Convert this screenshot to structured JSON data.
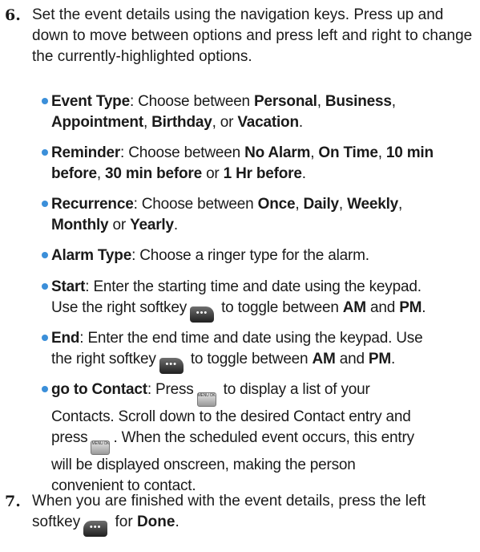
{
  "step6": {
    "number": "6.",
    "text": "Set the event details using the navigation keys. Press up and down to move between options and press left and right to change the currently-highlighted options."
  },
  "bullets": {
    "event_type": {
      "label": "Event Type",
      "t1": ": Choose between ",
      "o1": "Personal",
      "s1": ", ",
      "o2": "Business",
      "s2": ",",
      "o3": "Appointment",
      "s3": ", ",
      "o4": "Birthday",
      "s4": ", or ",
      "o5": "Vacation",
      "s5": "."
    },
    "reminder": {
      "label": "Reminder",
      "t1": ": Choose between ",
      "o1": "No Alarm",
      "s1": ", ",
      "o2": "On Time",
      "s2": ", ",
      "o3": "10 min",
      "o3b": "before",
      "s3": ", ",
      "o4": "30 min before",
      "s4": " or ",
      "o5": "1 Hr before",
      "s5": "."
    },
    "recurrence": {
      "label": "Recurrence",
      "t1": ": Choose between ",
      "o1": "Once",
      "s1": ", ",
      "o2": "Daily",
      "s2": ", ",
      "o3": "Weekly",
      "s3": ",",
      "o4": "Monthly",
      "s4": " or ",
      "o5": "Yearly",
      "s5": "."
    },
    "alarm_type": {
      "label": "Alarm Type",
      "t1": ": Choose a ringer type for the alarm."
    },
    "start": {
      "label": "Start",
      "t1": ": Enter the starting time and date using the keypad.",
      "t2": "Use the right softkey",
      "t3": " to toggle between ",
      "am": "AM",
      "t4": " and ",
      "pm": "PM",
      "t5": "."
    },
    "end": {
      "label": "End",
      "t1": ": Enter the end time and date using the keypad. Use",
      "t2": "the right softkey",
      "t3": " to toggle between ",
      "am": "AM",
      "t4": " and ",
      "pm": "PM",
      "t5": "."
    },
    "go_to_contact": {
      "label": "go to Contact",
      "t1": ": Press",
      "t2": " to display a list of your",
      "t3": "Contacts. Scroll down to the desired Contact entry and",
      "t4": "press",
      "t5": ". When the scheduled event occurs, this entry",
      "t6": "will be displayed onscreen, making the person",
      "t7": "convenient to contact."
    }
  },
  "step7": {
    "number": "7.",
    "t1": "When you are finished with the event details, press the left",
    "t2": "softkey",
    "t3": " for ",
    "done": "Done",
    "t4": "."
  },
  "icons": {
    "softkey_glyph": "•••",
    "menu_key_label": "MENU OK"
  },
  "colors": {
    "bullet": "#3b8fd9",
    "text": "#1a1a1a",
    "softkey": "#2a2a2a"
  }
}
